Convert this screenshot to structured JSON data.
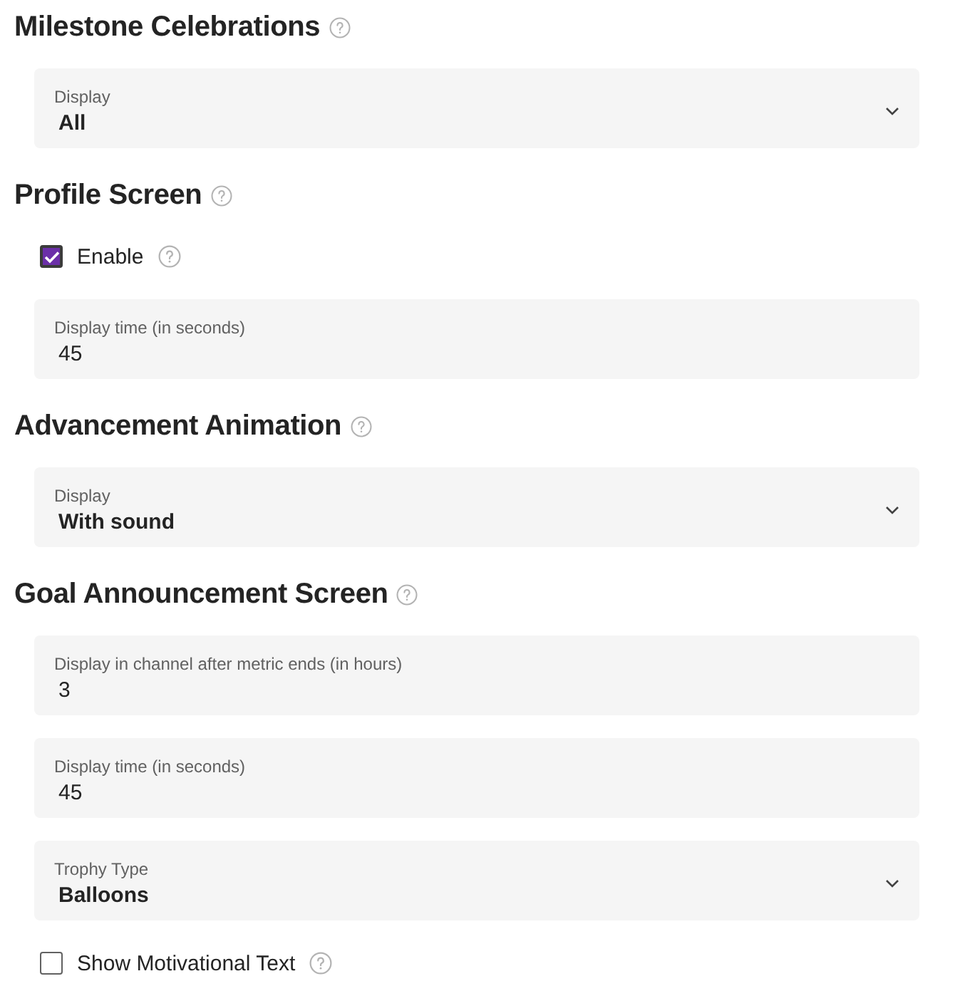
{
  "sections": [
    {
      "title": "Milestone Celebrations",
      "items": [
        {
          "kind": "select",
          "label": "Display",
          "value": "All"
        }
      ]
    },
    {
      "title": "Profile Screen",
      "items": [
        {
          "kind": "checkbox",
          "label": "Enable",
          "checked": true
        },
        {
          "kind": "text",
          "label": "Display time (in seconds)",
          "value": "45"
        }
      ]
    },
    {
      "title": "Advancement Animation",
      "items": [
        {
          "kind": "select",
          "label": "Display",
          "value": "With sound"
        }
      ]
    },
    {
      "title": "Goal Announcement Screen",
      "items": [
        {
          "kind": "text",
          "label": "Display in channel after metric ends (in hours)",
          "value": "3"
        },
        {
          "kind": "text",
          "label": "Display time (in seconds)",
          "value": "45"
        },
        {
          "kind": "select",
          "label": "Trophy Type",
          "value": "Balloons"
        },
        {
          "kind": "checkbox",
          "label": "Show Motivational Text",
          "checked": false
        }
      ]
    }
  ]
}
